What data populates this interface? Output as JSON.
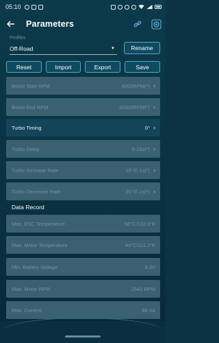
{
  "status_bar": {
    "time": "05:10"
  },
  "header": {
    "title": "Parameters"
  },
  "profile": {
    "label": "Profiles",
    "selected": "Off-Road",
    "rename_label": "Rename"
  },
  "actions": {
    "reset": "Reset",
    "import": "Import",
    "export": "Export",
    "save": "Save"
  },
  "parameters": [
    {
      "label": "Boost Start RPM",
      "value": "6000RPM(*)"
    },
    {
      "label": "Boost End RPM",
      "value": "32500RPM(*)"
    },
    {
      "label": "Turbo Timing",
      "value": "0°"
    },
    {
      "label": "Turbo Delay",
      "value": "0.15s(*)"
    },
    {
      "label": "Turbo Increase Rate",
      "value": "15°/0.1s(*)"
    },
    {
      "label": "Turbo Decrease Rate",
      "value": "25°/0.1s(*)"
    }
  ],
  "data_record": {
    "title": "Data Record",
    "items": [
      {
        "label": "Max. ESC Temperature",
        "value": "56°C/132.8°F"
      },
      {
        "label": "Max. Motor Temperature",
        "value": "44°C/111.2°F"
      },
      {
        "label": "Min. Battery Voltage",
        "value": "8.3V"
      },
      {
        "label": "Max. Motor RPM",
        "value": "2542 RPM"
      },
      {
        "label": "Max. Current",
        "value": "88.6A"
      }
    ]
  },
  "colors": {
    "background": "#0c3a4b",
    "row_disabled": "#3b6170",
    "row_active": "#14445a",
    "button_border": "#58a7c2"
  }
}
